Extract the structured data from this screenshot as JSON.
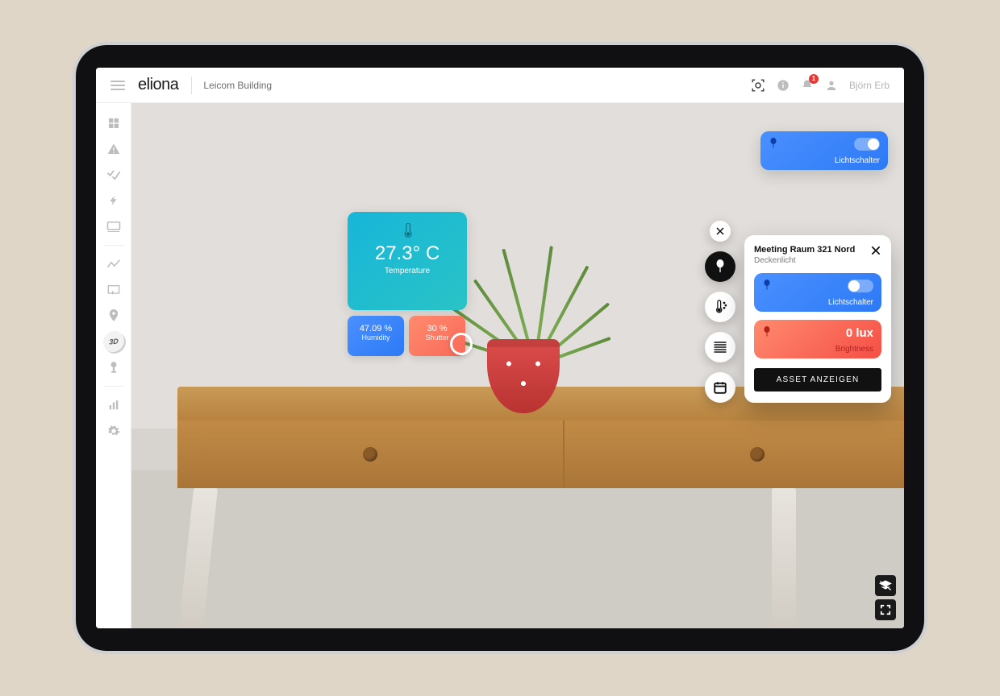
{
  "header": {
    "brand": "eliona",
    "building": "Leicom Building",
    "notification_count": "1",
    "username": "Björn Erb"
  },
  "sidebar": {
    "items": [
      {
        "name": "dashboard"
      },
      {
        "name": "alerts"
      },
      {
        "name": "tasks"
      },
      {
        "name": "energy"
      },
      {
        "name": "devices"
      },
      {
        "name": "trends"
      },
      {
        "name": "views"
      },
      {
        "name": "locations"
      },
      {
        "name": "3d",
        "label": "3D"
      },
      {
        "name": "heatmap"
      },
      {
        "name": "analytics"
      },
      {
        "name": "settings"
      }
    ]
  },
  "overlay": {
    "temperature": {
      "value": "27.3° C",
      "label": "Temperature"
    },
    "humidity": {
      "value": "47.09 %",
      "label": "Humidity"
    },
    "shutter": {
      "value": "30 %",
      "label": "Shutter"
    }
  },
  "actions": [
    "close",
    "light",
    "temperature-humidity",
    "blinds",
    "calendar"
  ],
  "light_top": {
    "label": "Lichtschalter",
    "state": "on"
  },
  "panel": {
    "title": "Meeting Raum 321 Nord",
    "subtitle": "Deckenlicht",
    "light": {
      "label": "Lichtschalter",
      "state": "off"
    },
    "brightness": {
      "value": "0 lux",
      "label": "Brightness"
    },
    "action": "ASSET ANZEIGEN"
  },
  "corner_tools": [
    "layers",
    "fullscreen"
  ]
}
